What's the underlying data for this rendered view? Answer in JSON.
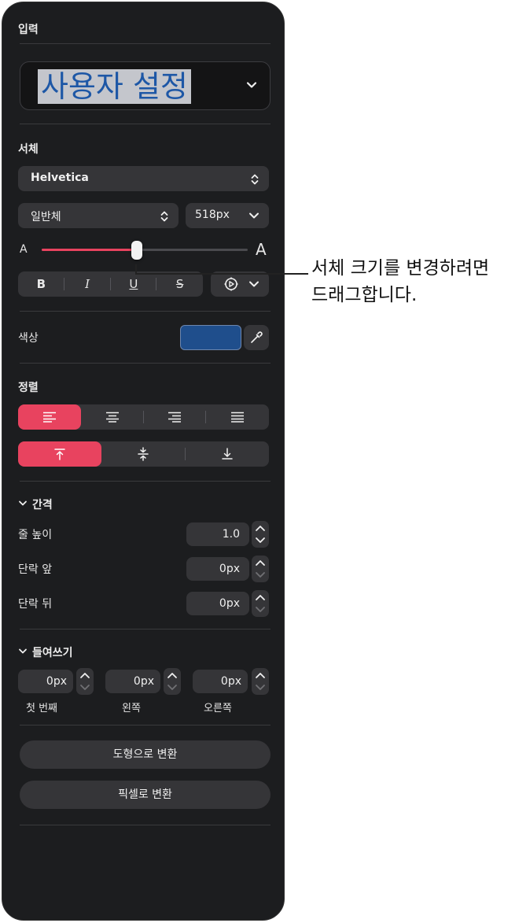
{
  "input_section": {
    "title": "입력",
    "text_value": "사용자 설정"
  },
  "font_section": {
    "title": "서체",
    "font_family": "Helvetica",
    "font_style": "일반체",
    "font_size": "518px",
    "slider_min_label": "A",
    "slider_max_label": "A",
    "slider_value_fraction": 0.46,
    "format_buttons": [
      "B",
      "I",
      "U",
      "S"
    ]
  },
  "color_section": {
    "title": "색상",
    "swatch_color": "#1f4e8c"
  },
  "align_section": {
    "title": "정렬",
    "horizontal_selected": 0,
    "vertical_selected": 0
  },
  "spacing_section": {
    "title": "간격",
    "line_height_label": "줄 높이",
    "line_height_value": "1.0",
    "before_label": "단락 앞",
    "before_value": "0px",
    "after_label": "단락 뒤",
    "after_value": "0px"
  },
  "indent_section": {
    "title": "들여쓰기",
    "first_value": "0px",
    "first_label": "첫 번째",
    "left_value": "0px",
    "left_label": "왼쪽",
    "right_value": "0px",
    "right_label": "오른쪽"
  },
  "actions": {
    "convert_shape": "도형으로 변환",
    "convert_pixels": "픽셀로 변환"
  },
  "callout": {
    "line1": "서체 크기를 변경하려면",
    "line2": "드래그합니다."
  },
  "colors": {
    "accent": "#e8435f",
    "panel": "#1c1d1f",
    "control": "#353538"
  }
}
